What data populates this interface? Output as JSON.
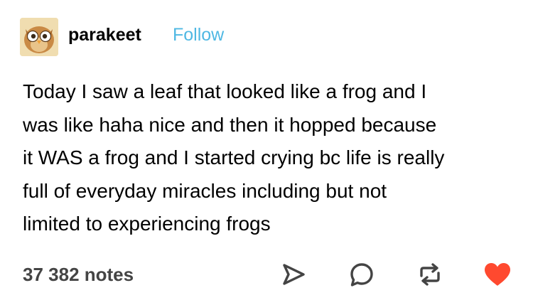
{
  "post": {
    "author": "parakeet",
    "follow_label": "Follow",
    "body_lines": [
      "Today I saw a leaf that looked like a frog and I",
      "was like haha nice and then it hopped because",
      "it WAS a frog and I started crying bc life is really",
      "full of everyday miracles including but not",
      "limited to experiencing frogs"
    ],
    "notes": "37 382 notes"
  },
  "actions": [
    {
      "name": "share",
      "icon": "share-icon"
    },
    {
      "name": "reply",
      "icon": "reply-icon"
    },
    {
      "name": "reblog",
      "icon": "reblog-icon"
    },
    {
      "name": "like",
      "icon": "heart-icon"
    }
  ],
  "colors": {
    "follow": "#4fb8e3",
    "notes": "#444444",
    "icons": "#444444",
    "heart": "#ff492f",
    "avatar_bg": "#f0ddb0"
  }
}
